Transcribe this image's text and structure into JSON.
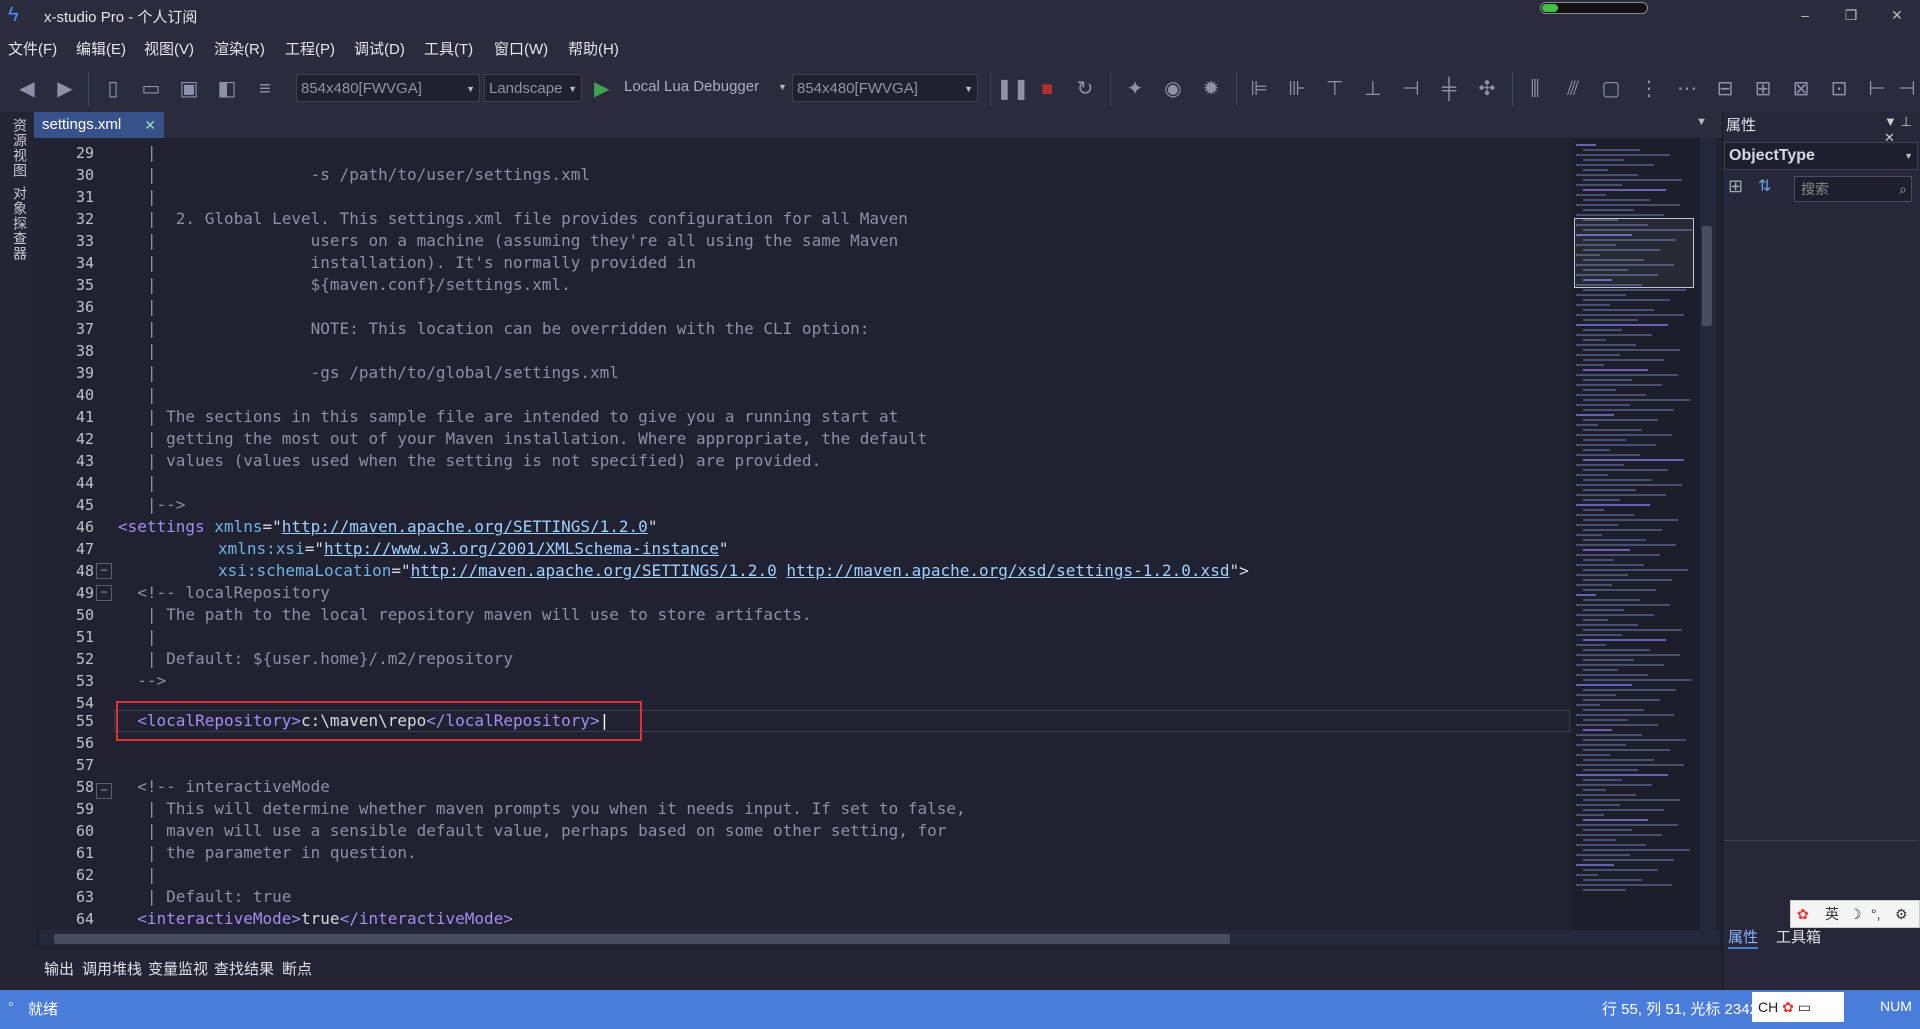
{
  "window": {
    "title": "x-studio Pro - 个人订阅",
    "controls": [
      "–",
      "❐",
      "✕"
    ],
    "progress": 0.15
  },
  "menu": [
    "文件(F)",
    "编辑(E)",
    "视图(V)",
    "渲染(R)",
    "工程(P)",
    "调试(D)",
    "工具(T)",
    "窗口(W)",
    "帮助(H)"
  ],
  "toolbar": {
    "resolution": "854x480[FWVGA]",
    "orientation": "Landscape",
    "debugger": "Local Lua Debugger",
    "resolution2": "854x480[FWVGA]"
  },
  "left_tabs": [
    "资源视图",
    "对象探查器"
  ],
  "document_tab": {
    "label": "settings.xml",
    "close": "✕"
  },
  "code_lines": [
    {
      "n": "29",
      "text": "   |"
    },
    {
      "n": "30",
      "text": "   |                -s /path/to/user/settings.xml"
    },
    {
      "n": "31",
      "text": "   |"
    },
    {
      "n": "32",
      "text": "   |  2. Global Level. This settings.xml file provides configuration for all Maven"
    },
    {
      "n": "33",
      "text": "   |                users on a machine (assuming they're all using the same Maven"
    },
    {
      "n": "34",
      "text": "   |                installation). It's normally provided in"
    },
    {
      "n": "35",
      "text": "   |                ${maven.conf}/settings.xml."
    },
    {
      "n": "36",
      "text": "   |"
    },
    {
      "n": "37",
      "text": "   |                NOTE: This location can be overridden with the CLI option:"
    },
    {
      "n": "38",
      "text": "   |"
    },
    {
      "n": "39",
      "text": "   |                -gs /path/to/global/settings.xml"
    },
    {
      "n": "40",
      "text": "   |"
    },
    {
      "n": "41",
      "text": "   | The sections in this sample file are intended to give you a running start at"
    },
    {
      "n": "42",
      "text": "   | getting the most out of your Maven installation. Where appropriate, the default"
    },
    {
      "n": "43",
      "text": "   | values (values used when the setting is not specified) are provided."
    },
    {
      "n": "44",
      "text": "   |"
    },
    {
      "n": "45",
      "text": "   |-->"
    }
  ],
  "settings_lines": {
    "l46_n": "46",
    "l46_tag": "<settings ",
    "l46_attr": "xmlns",
    "l46_eq": "=\"",
    "l46_url": "http://maven.apache.org/SETTINGS/1.2.0",
    "l46_end": "\"",
    "l47_n": "47",
    "l47_attr": "xmlns:xsi",
    "l47_eq": "=\"",
    "l47_url": "http://www.w3.org/2001/XMLSchema-instance",
    "l47_end": "\"",
    "l48_n": "48",
    "l48_attr": "xsi:schemaLocation",
    "l48_eq": "=\"",
    "l48_url1": "http://maven.apache.org/SETTINGS/1.2.0",
    "l48_url2": "http://maven.apache.org/xsd/settings-1.2.0.xsd",
    "l48_end": "\">"
  },
  "code_lines2": [
    {
      "n": "49",
      "text": "  <!-- localRepository"
    },
    {
      "n": "50",
      "text": "   | The path to the local repository maven will use to store artifacts."
    },
    {
      "n": "51",
      "text": "   |"
    },
    {
      "n": "52",
      "text": "   | Default: ${user.home}/.m2/repository"
    },
    {
      "n": "53",
      "text": "  -->"
    },
    {
      "n": "54",
      "text": ""
    }
  ],
  "line55": {
    "n": "55",
    "open": "<localRepository>",
    "value": "c:\\maven\\repo",
    "close": "</localRepository>"
  },
  "code_lines3": [
    {
      "n": "56",
      "text": ""
    },
    {
      "n": "57",
      "text": ""
    },
    {
      "n": "58",
      "text": "  <!-- interactiveMode"
    },
    {
      "n": "59",
      "text": "   | This will determine whether maven prompts you when it needs input. If set to false,"
    },
    {
      "n": "60",
      "text": "   | maven will use a sensible default value, perhaps based on some other setting, for"
    },
    {
      "n": "61",
      "text": "   | the parameter in question."
    },
    {
      "n": "62",
      "text": "   |"
    },
    {
      "n": "63",
      "text": "   | Default: true"
    }
  ],
  "line64": {
    "n": "64",
    "open": "<interactiveMode>",
    "value": "true",
    "close": "</interactiveMode>"
  },
  "properties": {
    "title": "属性",
    "object_type": "ObjectType",
    "search_placeholder": "搜索",
    "tab_props": "属性",
    "tab_toolbox": "工具箱"
  },
  "ime": {
    "items": [
      "英",
      "☽",
      "°,",
      "⚙"
    ]
  },
  "output_tabs": [
    "输出",
    "调用堆栈",
    "变量监视",
    "查找结果",
    "断点"
  ],
  "status": {
    "ready": "就绪",
    "position": "行  55, 列   51, 光标 2342",
    "ime": "CH",
    "num": "NUM"
  }
}
